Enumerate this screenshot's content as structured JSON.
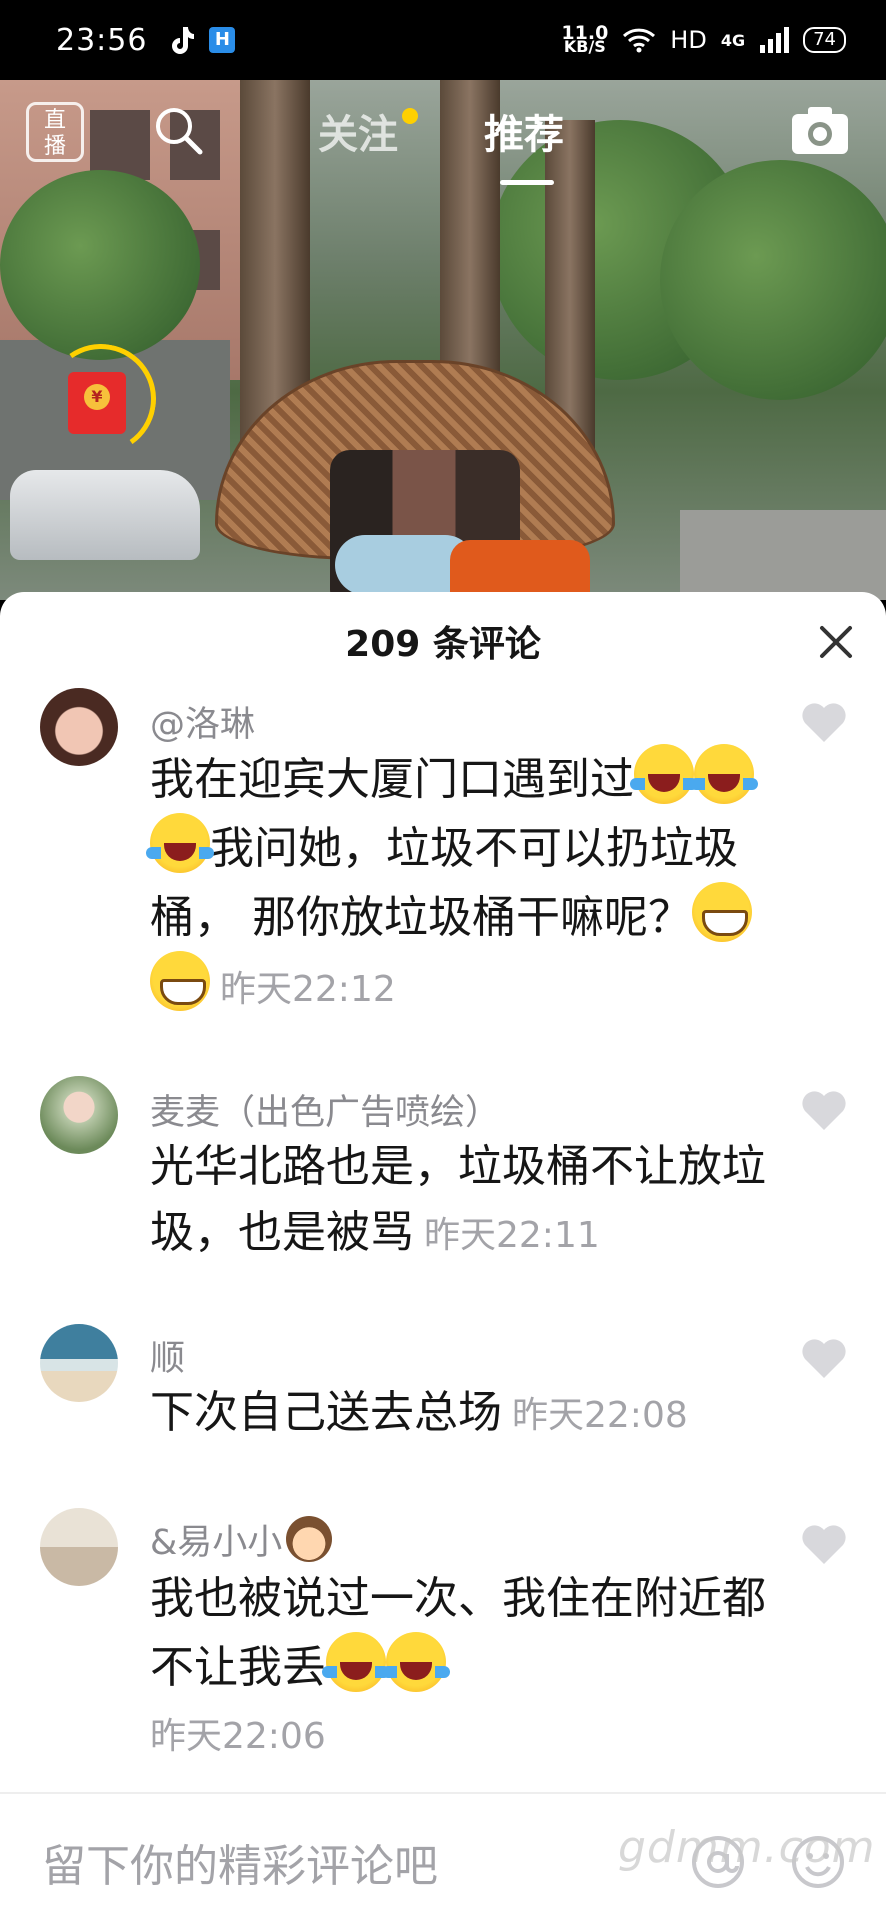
{
  "status_bar": {
    "time": "23:56",
    "net_speed": "11.0",
    "net_unit": "KB/S",
    "hd": "HD",
    "network": "4G",
    "battery": "74"
  },
  "top_nav": {
    "live_label": "直播",
    "tabs": [
      {
        "label": "关注",
        "active": false,
        "has_dot": true
      },
      {
        "label": "推荐",
        "active": true
      }
    ]
  },
  "comments_sheet": {
    "title": "209 条评论",
    "comments": [
      {
        "user": "@洛琳",
        "text_parts": [
          "我在迎宾大厦门口遇到过",
          "我问她，垃圾不可以扔垃圾桶， 那你放垃圾桶干嘛呢？"
        ],
        "time": "昨天22:12"
      },
      {
        "user": "麦麦（出色广告喷绘）",
        "text": "光华北路也是，垃圾桶不让放垃圾，也是被骂",
        "time": "昨天22:11"
      },
      {
        "user": "顺",
        "text": "下次自己送去总场",
        "time": "昨天22:08"
      },
      {
        "user": "&易小小",
        "text": "我也被说过一次、我住在附近都不让我丢",
        "time": "昨天22:06"
      }
    ]
  },
  "input": {
    "placeholder": "留下你的精彩评论吧"
  },
  "watermark": "gdmm.com",
  "colors": {
    "accent_dot": "#ffd000",
    "red_packet": "#e62b2b"
  }
}
